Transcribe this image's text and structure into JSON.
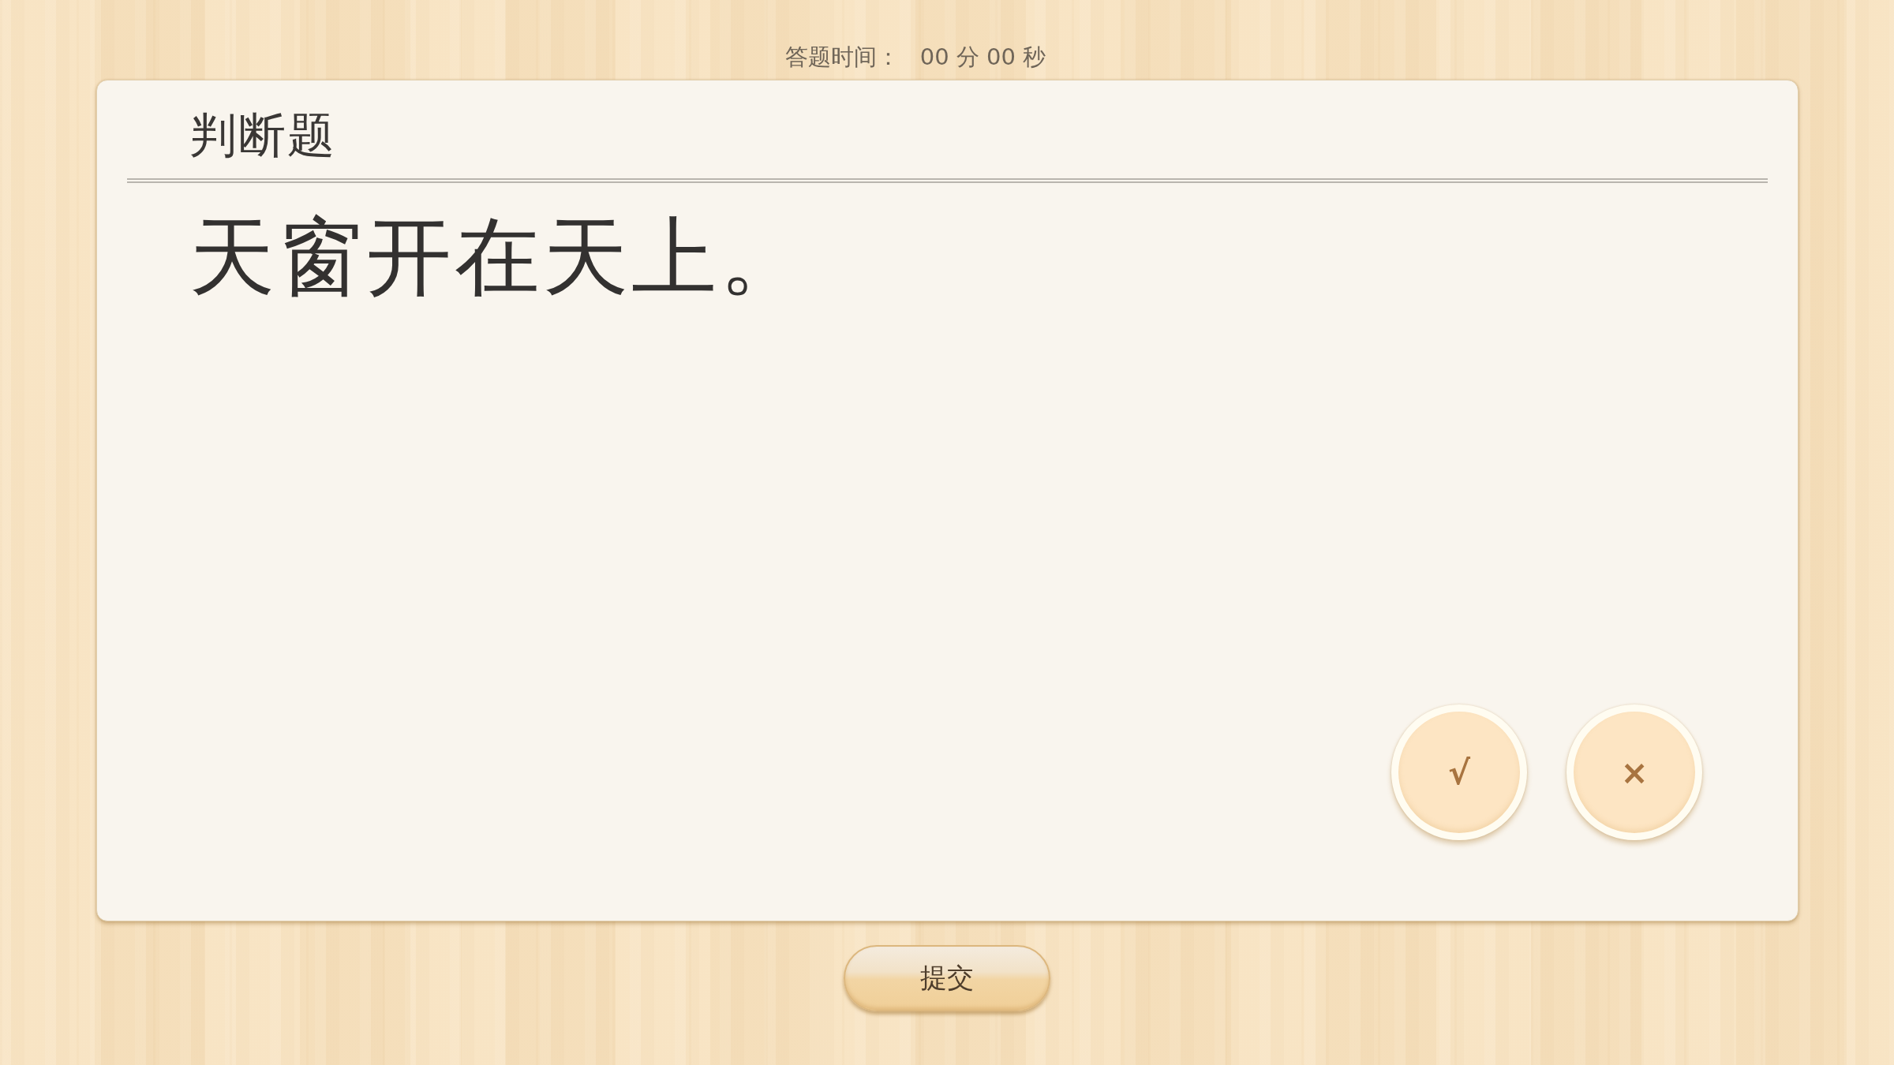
{
  "timer": {
    "label": "答题时间：",
    "value": "00 分 00 秒"
  },
  "question": {
    "type": "判断题",
    "text": "天窗开在天上。"
  },
  "answers": [
    {
      "symbol": "√",
      "selected": false
    },
    {
      "symbol": "×",
      "selected": false
    }
  ],
  "submit": {
    "label": "提交"
  }
}
